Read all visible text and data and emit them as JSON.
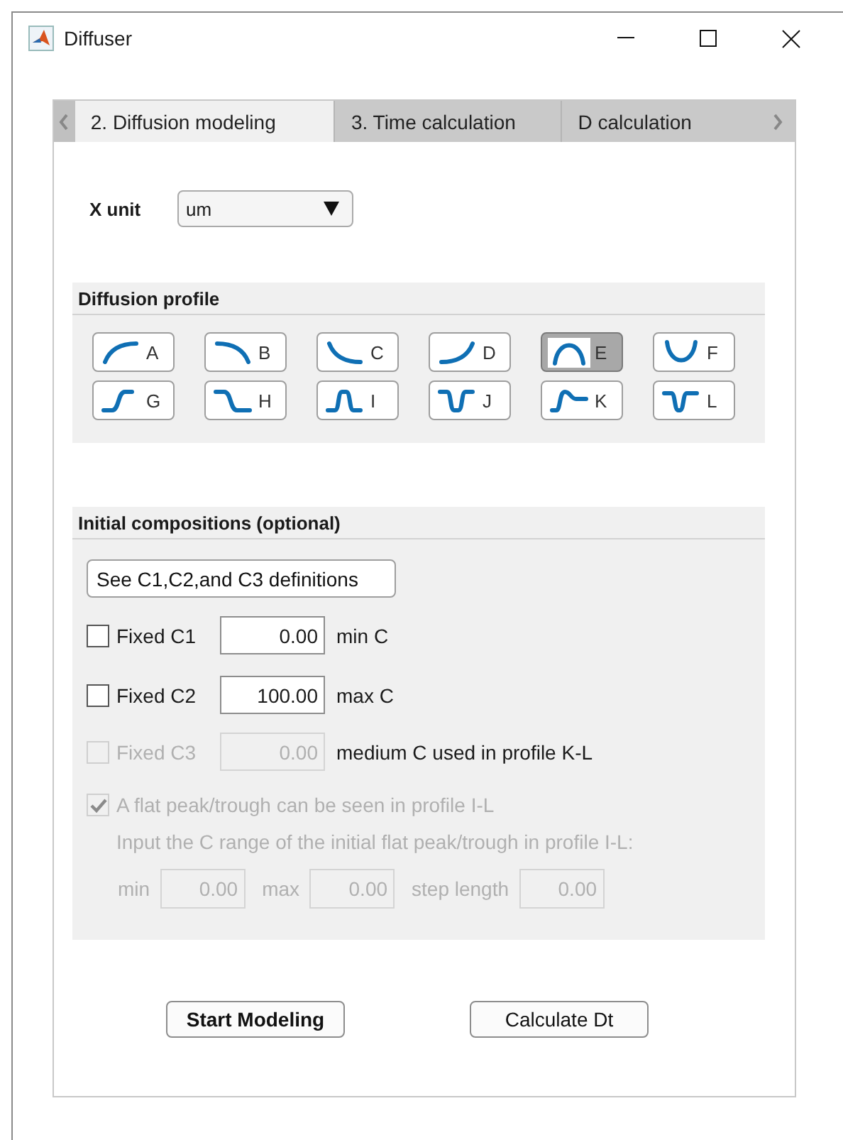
{
  "window": {
    "title": "Diffuser"
  },
  "tabs": [
    {
      "label": "2. Diffusion modeling",
      "selected": true
    },
    {
      "label": "3. Time calculation",
      "selected": false
    },
    {
      "label": "D calculation",
      "selected": false
    }
  ],
  "x_unit": {
    "label": "X unit",
    "value": "um"
  },
  "diffusion_profile": {
    "title": "Diffusion profile",
    "profiles": [
      {
        "label": "A",
        "selected": false
      },
      {
        "label": "B",
        "selected": false
      },
      {
        "label": "C",
        "selected": false
      },
      {
        "label": "D",
        "selected": false
      },
      {
        "label": "E",
        "selected": true
      },
      {
        "label": "F",
        "selected": false
      },
      {
        "label": "G",
        "selected": false
      },
      {
        "label": "H",
        "selected": false
      },
      {
        "label": "I",
        "selected": false
      },
      {
        "label": "J",
        "selected": false
      },
      {
        "label": "K",
        "selected": false
      },
      {
        "label": "L",
        "selected": false
      }
    ]
  },
  "initial_compositions": {
    "title": "Initial compositions (optional)",
    "definitions_button": "See C1,C2,and C3 definitions",
    "fixed": [
      {
        "label": "Fixed C1",
        "checked": false,
        "disabled": false,
        "value": "0.00",
        "unit": "min C"
      },
      {
        "label": "Fixed C2",
        "checked": false,
        "disabled": false,
        "value": "100.00",
        "unit": "max C"
      },
      {
        "label": "Fixed C3",
        "checked": false,
        "disabled": true,
        "value": "0.00",
        "unit": "medium C used in profile K-L"
      }
    ],
    "flat_peak": {
      "label": "A flat peak/trough can be seen in profile I-L",
      "checked": true,
      "disabled": true
    },
    "range_hint": "Input the C range of the initial flat peak/trough in profile I-L:",
    "range_disabled": true,
    "range_fields": [
      {
        "label": "min",
        "value": "0.00"
      },
      {
        "label": "max",
        "value": "0.00"
      },
      {
        "label": "step length",
        "value": "0.00"
      }
    ]
  },
  "buttons": [
    {
      "label": "Start Modeling",
      "default": true
    },
    {
      "label": "Calculate Dt",
      "default": false
    }
  ]
}
